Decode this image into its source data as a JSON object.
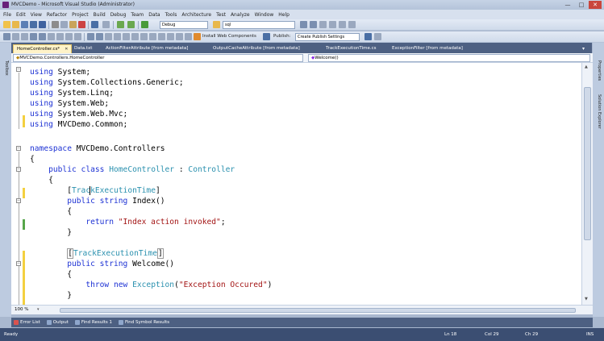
{
  "window": {
    "title": "MVCDemo - Microsoft Visual Studio (Administrator)",
    "minimize_glyph": "—",
    "maximize_glyph": "□",
    "close_glyph": "✕"
  },
  "menu": [
    "File",
    "Edit",
    "View",
    "Refactor",
    "Project",
    "Build",
    "Debug",
    "Team",
    "Data",
    "Tools",
    "Architecture",
    "Test",
    "Analyze",
    "Window",
    "Help"
  ],
  "toolbar": {
    "config_value": "Debug",
    "find_value": "sql",
    "install_web_components": "Install Web Components",
    "publish_label": "Publish:",
    "publish_value": "Create Publish Settings"
  },
  "tabs": [
    {
      "label": "HomeController.cs*",
      "active": true
    },
    {
      "label": "Data.txt",
      "active": false
    },
    {
      "label": "ActionFilterAttribute [from metadata]",
      "active": false
    },
    {
      "label": "OutputCacheAttribute [from metadata]",
      "active": false
    },
    {
      "label": "TrackExecutionTime.cs",
      "active": false
    },
    {
      "label": "ExceptionFilter [from metadata]",
      "active": false
    }
  ],
  "left_panel": {
    "toolbox_label": "Toolbox"
  },
  "right_panel": {
    "properties_label": "Properties",
    "solution_explorer_label": "Solution Explorer"
  },
  "navbar": {
    "type_value": "MVCDemo.Controllers.HomeController",
    "member_value": "Welcome()"
  },
  "code": {
    "l1_kw": "using",
    "l1_rest": " System;",
    "l2_kw": "using",
    "l2_rest": " System.Collections.Generic;",
    "l3_kw": "using",
    "l3_rest": " System.Linq;",
    "l4_kw": "using",
    "l4_rest": " System.Web;",
    "l5_kw": "using",
    "l5_rest": " System.Web.Mvc;",
    "l6_kw": "using",
    "l6_rest": " MVCDemo.Common;",
    "l8_kw": "namespace",
    "l8_rest": " MVCDemo.Controllers",
    "l9": "{",
    "l10_indent": "    ",
    "l10_kw1": "public",
    "l10_sp1": " ",
    "l10_kw2": "class",
    "l10_sp2": " ",
    "l10_name": "HomeController",
    "l10_colon": " : ",
    "l10_base": "Controller",
    "l11": "    {",
    "l12_indent": "        ",
    "l12_open": "[",
    "l12_attr_a": "Trac",
    "l12_attr_b": "kExecutionTime",
    "l12_close": "]",
    "l13_indent": "        ",
    "l13_kw1": "public",
    "l13_sp": " ",
    "l13_kw2": "string",
    "l13_rest": " Index()",
    "l14": "        {",
    "l15_indent": "            ",
    "l15_kw": "return",
    "l15_sp": " ",
    "l15_str": "\"Index action invoked\"",
    "l15_end": ";",
    "l16": "        }",
    "l18_indent": "        ",
    "l18_open": "[",
    "l18_attr": "TrackExecutionTime",
    "l18_close": "]",
    "l19_indent": "        ",
    "l19_kw1": "public",
    "l19_sp": " ",
    "l19_kw2": "string",
    "l19_rest": " Welcome()",
    "l20": "        {",
    "l21_indent": "            ",
    "l21_kw1": "throw",
    "l21_sp1": " ",
    "l21_kw2": "new",
    "l21_sp2": " ",
    "l21_type": "Exception",
    "l21_open": "(",
    "l21_str": "\"Exception Occured\"",
    "l21_end": ")",
    "l22": "        }"
  },
  "editor": {
    "zoom": "100 %"
  },
  "bottom_tabs": [
    "Error List",
    "Output",
    "Find Results 1",
    "Find Symbol Results"
  ],
  "status": {
    "ready": "Ready",
    "line": "Ln 18",
    "col": "Col 29",
    "ch": "Ch 29",
    "ins": "INS"
  },
  "colors": {
    "keyword": "#1d32d4",
    "type": "#2b91af",
    "string": "#a31515",
    "status_bar": "#3b4e72"
  }
}
